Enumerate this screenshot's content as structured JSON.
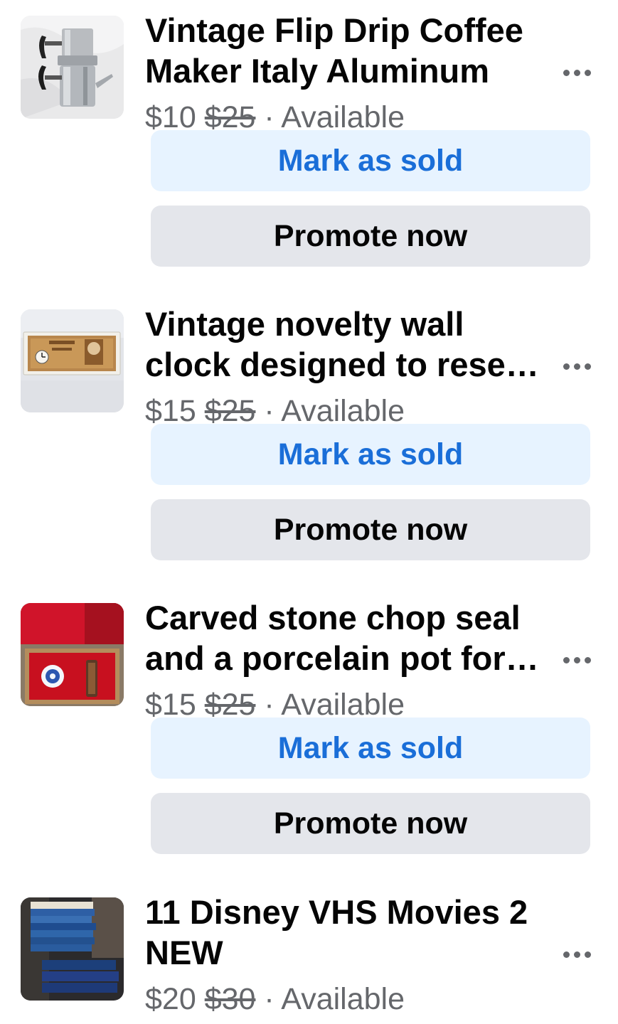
{
  "listings": [
    {
      "title": "Vintage Flip Drip Coffee Maker Italy Aluminum",
      "price": "$10",
      "original_price": "$25",
      "separator": " · ",
      "status": "Available",
      "mark_sold_label": "Mark as sold",
      "promote_label": "Promote now",
      "thumbnail": "coffee-maker-photo"
    },
    {
      "title": "Vintage novelty wall clock designed to rese…",
      "price": "$15",
      "original_price": "$25",
      "separator": " · ",
      "status": "Available",
      "mark_sold_label": "Mark as sold",
      "promote_label": "Promote now",
      "thumbnail": "banknote-clock-photo"
    },
    {
      "title": "Carved stone chop seal and a porcelain pot for…",
      "price": "$15",
      "original_price": "$25",
      "separator": " · ",
      "status": "Available",
      "mark_sold_label": "Mark as sold",
      "promote_label": "Promote now",
      "thumbnail": "chop-seal-box-photo"
    },
    {
      "title": "11 Disney VHS Movies 2 NEW",
      "price": "$20",
      "original_price": "$30",
      "separator": " · ",
      "status": "Available",
      "thumbnail": "vhs-stack-photo"
    }
  ],
  "colors": {
    "mark_sold_bg": "#e7f3ff",
    "mark_sold_text": "#1a6ed8",
    "promote_bg": "#e4e6eb",
    "secondary_text": "#65676b"
  },
  "icons": {
    "more": "more-options-icon"
  }
}
